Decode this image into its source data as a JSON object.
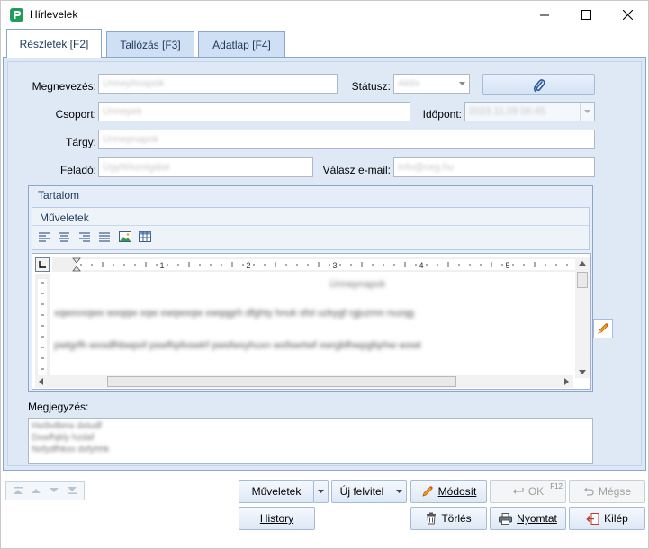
{
  "window": {
    "title": "Hírlevelek",
    "accent_color": "#1e9e5a"
  },
  "tabs": [
    {
      "label": "Részletek [F2]",
      "active": true
    },
    {
      "label": "Tallózás [F3]",
      "active": false
    },
    {
      "label": "Adatlap [F4]",
      "active": false
    }
  ],
  "form": {
    "megnevezes_label": "Megnevezés:",
    "megnevezes_value": "Unnephnapok",
    "statusz_label": "Státusz:",
    "statusz_value": "Aktív",
    "csoport_label": "Csoport:",
    "csoport_value": "Ünnepek",
    "idopont_label": "Időpont:",
    "idopont_value": "2023.11.09 06:45",
    "targy_label": "Tárgy:",
    "targy_value": "Ünnepnapok",
    "felado_label": "Feladó:",
    "felado_value": "Ügyfélszolgálat",
    "valasz_label": "Válasz e-mail:",
    "valasz_value": "info@ceg.hu",
    "attach_icon": "paperclip-icon"
  },
  "content": {
    "group_title": "Tartalom",
    "ops_title": "Műveletek",
    "toolbar_icons": [
      "align-left-icon",
      "align-center-icon",
      "align-right-icon",
      "align-justify-icon",
      "image-icon",
      "table-icon"
    ],
    "ruler_numbers": [
      "1",
      "2",
      "3",
      "4",
      "5"
    ],
    "doc_heading": "Ünnepnapok",
    "doc_line1": "xqwxvxqwx wxqqw    xqw xwqwxqw xwqqgrh dfghty hnuk sfol uzkygf rgjuzmn nuzqg",
    "doc_line2": "pwtgrfh wxsdfhbwpof pswfhpfxswtrf pwsfwxyhuxn wxfswrtwf xwrgbfhwpgfqrhw wxwt"
  },
  "notes": {
    "label": "Megjegyzés:",
    "lines": [
      "Hxrbvtbmx   dxtudf",
      "Dxwfhjkly hzdaf",
      "Nxfydfhkxx dxfyhhk"
    ]
  },
  "buttons": {
    "muveletek": "Műveletek",
    "uj_felvitel": "Új felvitel",
    "modosit": "Módosít",
    "ok": "OK",
    "ok_shortcut": "F12",
    "megse": "Mégse",
    "history": "History",
    "torles": "Törlés",
    "nyomtat": "Nyomtat",
    "kilep": "Kilép"
  }
}
